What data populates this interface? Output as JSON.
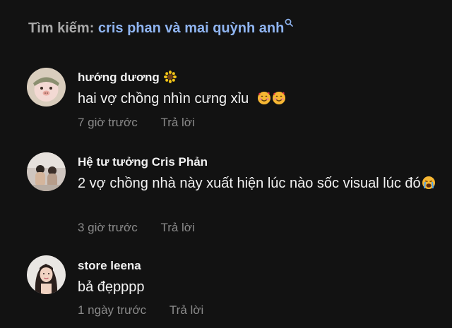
{
  "search": {
    "prefix": "Tìm kiếm:",
    "query": "cris phan và mai quỳnh anh"
  },
  "comments": [
    {
      "username": "hướng dương",
      "username_emoji": "sunflower",
      "text": "hai vợ chồng nhìn cưng xỉu",
      "text_emojis": [
        "smiling-face-with-hearts",
        "smiling-face-with-hearts"
      ],
      "time": "7 giờ trước",
      "reply_label": "Trả lời"
    },
    {
      "username": "Hệ tư tưởng Cris Phản",
      "text": "2 vợ chồng nhà này xuất hiện lúc nào sốc visual lúc đó",
      "text_emojis": [
        "loudly-crying-face"
      ],
      "time": "3 giờ trước",
      "reply_label": "Trả lời"
    },
    {
      "username": "store leena",
      "text": "bả đẹpppp",
      "time": "1 ngày trước",
      "reply_label": "Trả lời"
    }
  ],
  "colors": {
    "background": "#121212",
    "query": "#8fb4f0",
    "meta": "#8a8a8a"
  }
}
